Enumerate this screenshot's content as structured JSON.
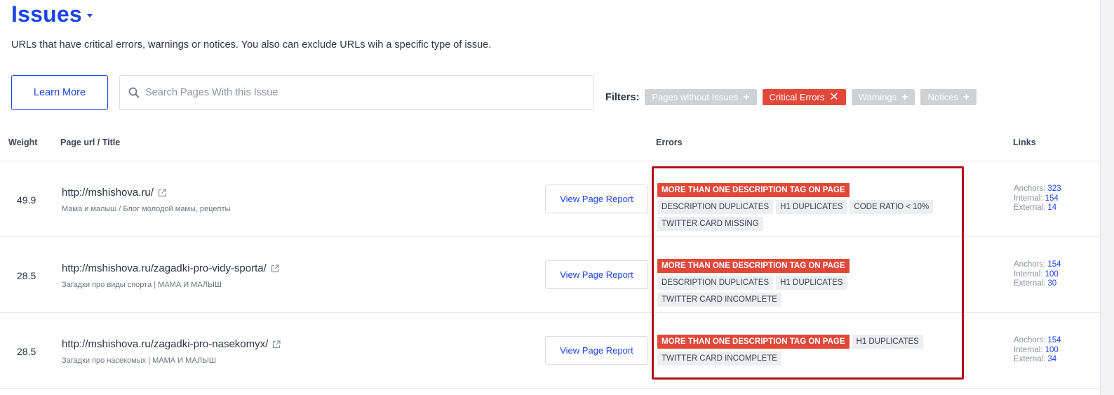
{
  "header": {
    "title": "Issues",
    "subtitle": "URLs that have critical errors, warnings or notices. You also can exclude URLs wih a specific type of issue."
  },
  "toolbar": {
    "learn_more_label": "Learn More",
    "search_placeholder": "Search Pages With this Issue",
    "filters_label": "Filters:",
    "filters": [
      {
        "label": "Pages without Issues",
        "active": false,
        "icon": "plus-icon"
      },
      {
        "label": "Critical Errors",
        "active": true,
        "icon": "close-icon"
      },
      {
        "label": "Warnings",
        "active": false,
        "icon": "plus-icon"
      },
      {
        "label": "Notices",
        "active": false,
        "icon": "plus-icon"
      }
    ]
  },
  "table": {
    "columns": {
      "weight": "Weight",
      "page": "Page url / Title",
      "errors": "Errors",
      "links": "Links"
    },
    "report_button_label": "View Page Report",
    "link_labels": {
      "anchors": "Anchors:",
      "internal": "Internal:",
      "external": "External:"
    },
    "rows": [
      {
        "weight": "49.9",
        "url": "http://mshishova.ru/",
        "title": "Мама и малыш / Блог молодой мамы, рецепты",
        "errors_critical": [
          "MORE THAN ONE DESCRIPTION TAG ON PAGE"
        ],
        "errors_other": [
          "DESCRIPTION DUPLICATES",
          "H1 DUPLICATES",
          "CODE RATIO < 10%",
          "TWITTER CARD MISSING"
        ],
        "anchors": "323",
        "internal": "154",
        "external": "14"
      },
      {
        "weight": "28.5",
        "url": "http://mshishova.ru/zagadki-pro-vidy-sporta/",
        "title": "Загадки про виды спорта | МАМА И МАЛЫШ",
        "errors_critical": [
          "MORE THAN ONE DESCRIPTION TAG ON PAGE"
        ],
        "errors_other": [
          "DESCRIPTION DUPLICATES",
          "H1 DUPLICATES",
          "TWITTER CARD INCOMPLETE"
        ],
        "anchors": "154",
        "internal": "100",
        "external": "30"
      },
      {
        "weight": "28.5",
        "url": "http://mshishova.ru/zagadki-pro-nasekomyx/",
        "title": "Загадки про насекомых | МАМА И МАЛЫШ",
        "errors_critical": [
          "MORE THAN ONE DESCRIPTION TAG ON PAGE"
        ],
        "errors_other": [
          "H1 DUPLICATES",
          "TWITTER CARD INCOMPLETE"
        ],
        "anchors": "154",
        "internal": "100",
        "external": "34"
      }
    ]
  },
  "colors": {
    "accent": "#1c44e8",
    "critical": "#e2483a",
    "highlight_border": "#b4101c",
    "chip_inactive": "#cfd1d5"
  }
}
